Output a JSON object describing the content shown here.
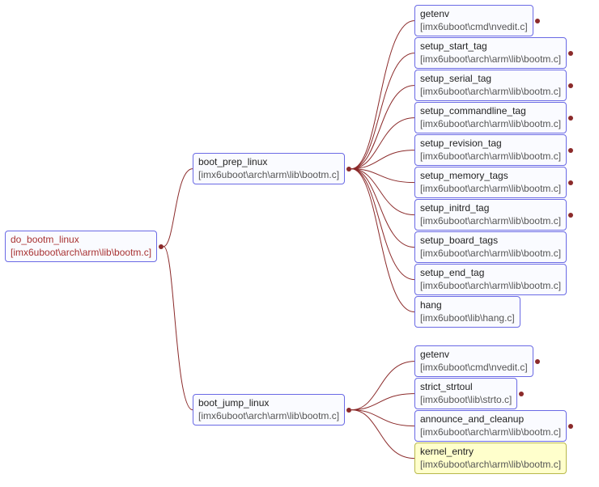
{
  "root": {
    "fn": "do_bootm_linux",
    "path": "[imx6uboot\\arch\\arm\\lib\\bootm.c]"
  },
  "mid": {
    "boot_prep": {
      "fn": "boot_prep_linux",
      "path": "[imx6uboot\\arch\\arm\\lib\\bootm.c]"
    },
    "boot_jump": {
      "fn": "boot_jump_linux",
      "path": "[imx6uboot\\arch\\arm\\lib\\bootm.c]"
    }
  },
  "prep_children": [
    {
      "fn": "getenv",
      "path": "[imx6uboot\\cmd\\nvedit.c]",
      "term": true
    },
    {
      "fn": "setup_start_tag",
      "path": "[imx6uboot\\arch\\arm\\lib\\bootm.c]",
      "term": true
    },
    {
      "fn": "setup_serial_tag",
      "path": "[imx6uboot\\arch\\arm\\lib\\bootm.c]",
      "term": true
    },
    {
      "fn": "setup_commandline_tag",
      "path": "[imx6uboot\\arch\\arm\\lib\\bootm.c]",
      "term": true
    },
    {
      "fn": "setup_revision_tag",
      "path": "[imx6uboot\\arch\\arm\\lib\\bootm.c]",
      "term": true
    },
    {
      "fn": "setup_memory_tags",
      "path": "[imx6uboot\\arch\\arm\\lib\\bootm.c]",
      "term": true
    },
    {
      "fn": "setup_initrd_tag",
      "path": "[imx6uboot\\arch\\arm\\lib\\bootm.c]",
      "term": true
    },
    {
      "fn": "setup_board_tags",
      "path": "[imx6uboot\\arch\\arm\\lib\\bootm.c]",
      "term": false
    },
    {
      "fn": "setup_end_tag",
      "path": "[imx6uboot\\arch\\arm\\lib\\bootm.c]",
      "term": false
    },
    {
      "fn": "hang",
      "path": "[imx6uboot\\lib\\hang.c]",
      "term": false
    }
  ],
  "jump_children": [
    {
      "fn": "getenv",
      "path": "[imx6uboot\\cmd\\nvedit.c]",
      "term": true
    },
    {
      "fn": "strict_strtoul",
      "path": "[imx6uboot\\lib\\strto.c]",
      "term": true
    },
    {
      "fn": "announce_and_cleanup",
      "path": "[imx6uboot\\arch\\arm\\lib\\bootm.c]",
      "term": true
    },
    {
      "fn": "kernel_entry",
      "path": "[imx6uboot\\arch\\arm\\lib\\bootm.c]",
      "term": false,
      "highlight": true
    }
  ],
  "chart_data": {
    "type": "tree",
    "title": "",
    "root": "do_bootm_linux",
    "edges": [
      [
        "do_bootm_linux",
        "boot_prep_linux"
      ],
      [
        "do_bootm_linux",
        "boot_jump_linux"
      ],
      [
        "boot_prep_linux",
        "getenv"
      ],
      [
        "boot_prep_linux",
        "setup_start_tag"
      ],
      [
        "boot_prep_linux",
        "setup_serial_tag"
      ],
      [
        "boot_prep_linux",
        "setup_commandline_tag"
      ],
      [
        "boot_prep_linux",
        "setup_revision_tag"
      ],
      [
        "boot_prep_linux",
        "setup_memory_tags"
      ],
      [
        "boot_prep_linux",
        "setup_initrd_tag"
      ],
      [
        "boot_prep_linux",
        "setup_board_tags"
      ],
      [
        "boot_prep_linux",
        "setup_end_tag"
      ],
      [
        "boot_prep_linux",
        "hang"
      ],
      [
        "boot_jump_linux",
        "getenv"
      ],
      [
        "boot_jump_linux",
        "strict_strtoul"
      ],
      [
        "boot_jump_linux",
        "announce_and_cleanup"
      ],
      [
        "boot_jump_linux",
        "kernel_entry"
      ]
    ]
  }
}
